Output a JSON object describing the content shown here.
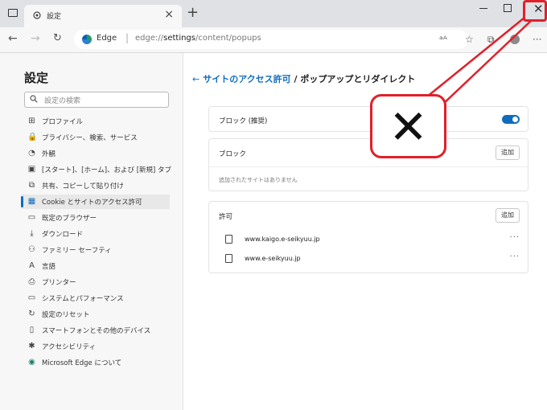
{
  "tab": {
    "title": "設定",
    "close": "×",
    "new": "+"
  },
  "window": {
    "close": "✕"
  },
  "address": {
    "brand": "Edge",
    "separator": "|",
    "url_prefix": "edge://",
    "url_host": "settings",
    "url_path": "/content/popups"
  },
  "sidebar": {
    "title": "設定",
    "search_placeholder": "設定の検索",
    "items": [
      {
        "icon": "profile-icon",
        "glyph": "⊞",
        "label": "プロファイル"
      },
      {
        "icon": "lock-icon",
        "glyph": "🔒",
        "label": "プライバシー、検索、サービス"
      },
      {
        "icon": "appearance-icon",
        "glyph": "◔",
        "label": "外観"
      },
      {
        "icon": "start-page-icon",
        "glyph": "▣",
        "label": "[スタート]、[ホーム]、および [新規] タブ"
      },
      {
        "icon": "share-icon",
        "glyph": "⧉",
        "label": "共有、コピーして貼り付け"
      },
      {
        "icon": "cookie-icon",
        "glyph": "▦",
        "label": "Cookie とサイトのアクセス許可"
      },
      {
        "icon": "default-browser-icon",
        "glyph": "▭",
        "label": "既定のブラウザー"
      },
      {
        "icon": "download-icon",
        "glyph": "⤓",
        "label": "ダウンロード"
      },
      {
        "icon": "family-icon",
        "glyph": "⚇",
        "label": "ファミリー セーフティ"
      },
      {
        "icon": "language-icon",
        "glyph": "A",
        "label": "言語"
      },
      {
        "icon": "printer-icon",
        "glyph": "⎙",
        "label": "プリンター"
      },
      {
        "icon": "system-icon",
        "glyph": "▭",
        "label": "システムとパフォーマンス"
      },
      {
        "icon": "reset-icon",
        "glyph": "↻",
        "label": "設定のリセット"
      },
      {
        "icon": "phone-icon",
        "glyph": "▯",
        "label": "スマートフォンとその他のデバイス"
      },
      {
        "icon": "accessibility-icon",
        "glyph": "✱",
        "label": "アクセシビリティ"
      },
      {
        "icon": "edge-logo-icon",
        "glyph": "◉",
        "label": "Microsoft Edge について"
      }
    ]
  },
  "main": {
    "back": "←",
    "breadcrumb_link": "サイトのアクセス許可",
    "breadcrumb_sep": " / ",
    "breadcrumb_current": "ポップアップとリダイレクト",
    "block_recommended": "ブロック (推奨)",
    "block_section": "ブロック",
    "add_label": "追加",
    "block_empty": "追加されたサイトはありません",
    "allow_section": "許可",
    "allow_sites": [
      "www.kaigo.e-seikyuu.jp",
      "www.e-seikyuu.jp"
    ],
    "more": "···"
  },
  "callout": {
    "glyph": "✕"
  },
  "colors": {
    "accent": "#0f6cbd",
    "highlight": "#e0202a"
  }
}
